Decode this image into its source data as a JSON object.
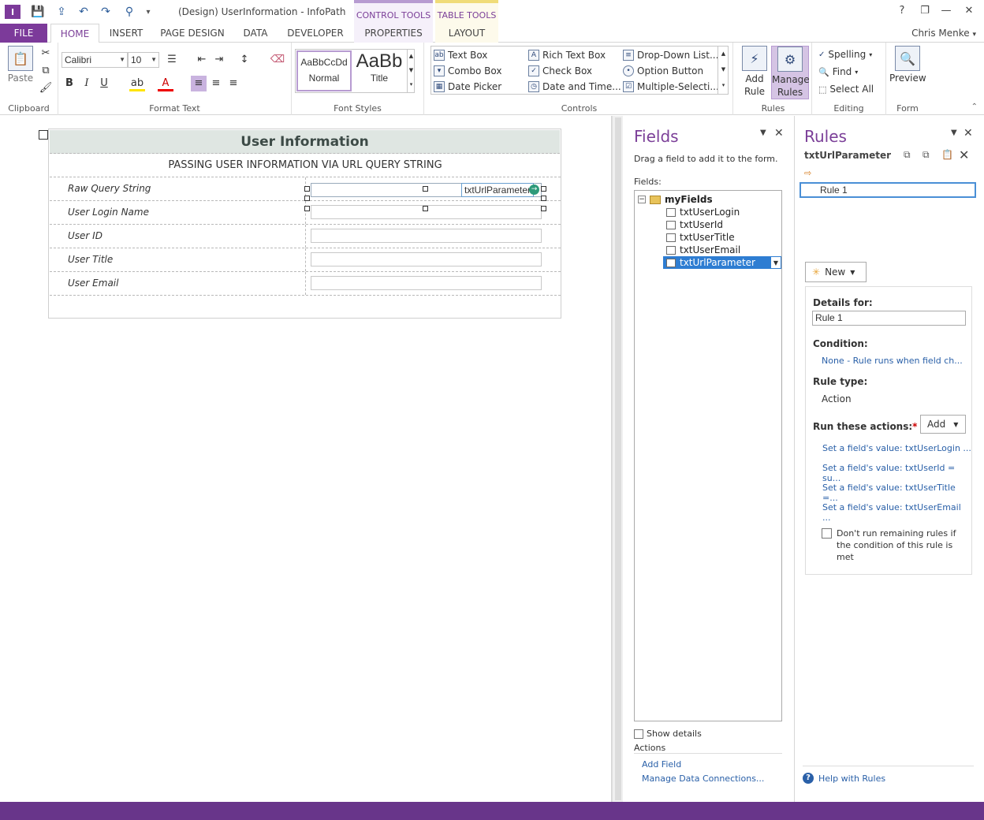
{
  "window": {
    "title": "(Design) UserInformation - InfoPath",
    "context_headers": {
      "control_tools": "CONTROL TOOLS",
      "table_tools": "TABLE TOOLS"
    },
    "controls": {
      "help": "?",
      "restore": "❐",
      "minimize": "—",
      "maximize": "☐",
      "close": "✕"
    },
    "qat": {
      "save": "💾",
      "publish": "⇪",
      "undo": "↶",
      "redo": "↷",
      "format_painter": "⚲",
      "customize": "▾"
    }
  },
  "tabs": {
    "file": "FILE",
    "home": "HOME",
    "insert": "INSERT",
    "page_design": "PAGE DESIGN",
    "data": "DATA",
    "developer": "DEVELOPER",
    "properties": "PROPERTIES",
    "layout": "LAYOUT"
  },
  "user": "Chris Menke",
  "ribbon": {
    "clipboard": {
      "label": "Clipboard",
      "paste": "Paste"
    },
    "format_text": {
      "label": "Format Text",
      "font": "Calibri",
      "size": "10",
      "bold": "B",
      "italic": "I",
      "underline": "U"
    },
    "font_styles": {
      "label": "Font Styles",
      "normal_sample": "AaBbCcDd",
      "normal": "Normal",
      "title_sample": "AaBb",
      "title": "Title"
    },
    "controls": {
      "label": "Controls",
      "items": [
        "Text Box",
        "Rich Text Box",
        "Drop-Down List...",
        "Combo Box",
        "Check Box",
        "Option Button",
        "Date Picker",
        "Date and Time...",
        "Multiple-Selecti..."
      ]
    },
    "rules": {
      "label": "Rules",
      "add_rule": "Add Rule",
      "manage_rules": "Manage Rules"
    },
    "editing": {
      "label": "Editing",
      "spelling": "Spelling",
      "find": "Find",
      "select_all": "Select All"
    },
    "form": {
      "label": "Form",
      "preview": "Preview"
    }
  },
  "form": {
    "title": "User Information",
    "subtitle": "PASSING USER INFORMATION VIA URL QUERY STRING",
    "selected_control_tag": "txtUrlParameter",
    "rows": [
      {
        "label": "Raw Query String"
      },
      {
        "label": "User Login Name"
      },
      {
        "label": "User ID"
      },
      {
        "label": "User Title"
      },
      {
        "label": "User Email"
      }
    ]
  },
  "fields_pane": {
    "title": "Fields",
    "instruction": "Drag a field to add it to the form.",
    "fields_label": "Fields:",
    "root": "myFields",
    "items": [
      "txtUserLogin",
      "txtUserId",
      "txtUserTitle",
      "txtUserEmail",
      "txtUrlParameter"
    ],
    "selected": "txtUrlParameter",
    "show_details": "Show details",
    "actions_label": "Actions",
    "add_field": "Add Field",
    "manage_data_connections": "Manage Data Connections..."
  },
  "rules_pane": {
    "title": "Rules",
    "field_name": "txtUrlParameter",
    "rule_list": [
      "Rule 1"
    ],
    "new_button": "New",
    "details_for": "Details for:",
    "rule_name": "Rule 1",
    "condition_label": "Condition:",
    "condition_value": "None - Rule runs when field ch...",
    "rule_type_label": "Rule type:",
    "rule_type_value": "Action",
    "run_actions_label": "Run these actions:",
    "required_mark": "*",
    "add_button": "Add",
    "actions": [
      "Set a field's value: txtUserLogin ...",
      "Set a field's value: txtUserId = su...",
      "Set a field's value: txtUserTitle =...",
      "Set a field's value: txtUserEmail ..."
    ],
    "dont_run_remaining": "Don't run remaining rules if the condition of this rule is met",
    "help": "Help with Rules"
  },
  "colors": {
    "accent": "#7b3f98",
    "file_tab": "#7c3a9a",
    "status_bar": "#68358a",
    "link": "#2a60a8"
  }
}
